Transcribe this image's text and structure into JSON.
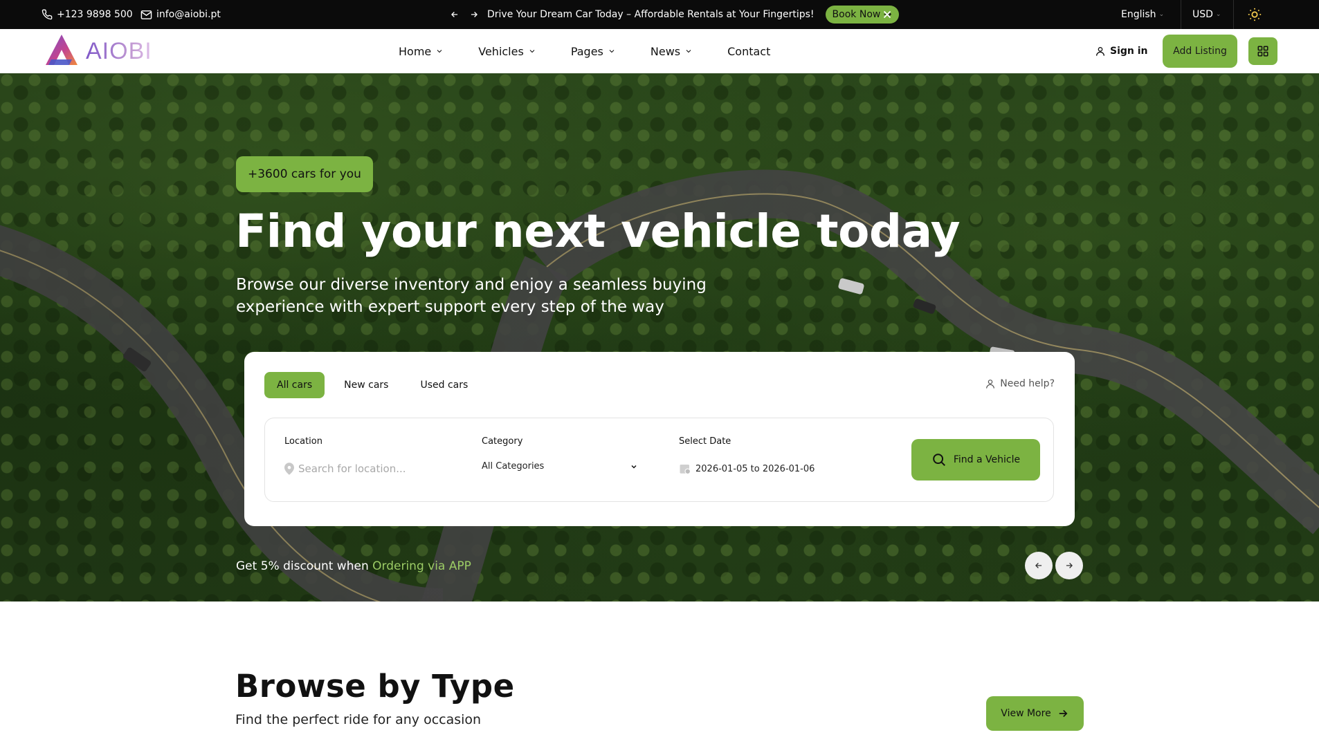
{
  "topbar": {
    "phone": "+123 9898 500",
    "email": "info@aiobi.pt",
    "promo_text": "Drive Your Dream Car Today – Affordable Rentals at Your Fingertips!",
    "book_now": "Book Now →",
    "language": "English",
    "currency": "USD"
  },
  "header": {
    "logo_text": "AIOBI",
    "nav": [
      {
        "label": "Home"
      },
      {
        "label": "Vehicles"
      },
      {
        "label": "Pages"
      },
      {
        "label": "News"
      },
      {
        "label": "Contact"
      }
    ],
    "sign_in": "Sign in",
    "add_listing": "Add Listing"
  },
  "hero": {
    "badge": "+3600 cars for you",
    "title": "Find your next vehicle today",
    "subtitle": "Browse our diverse inventory and enjoy a seamless buying experience with expert support every step of the way",
    "discount_prefix": "Get 5% discount when",
    "discount_link": "Ordering via APP"
  },
  "search": {
    "tabs": [
      {
        "label": "All cars",
        "active": true
      },
      {
        "label": "New cars",
        "active": false
      },
      {
        "label": "Used cars",
        "active": false
      }
    ],
    "help": "Need help?",
    "location_label": "Location",
    "location_placeholder": "Search for location...",
    "category_label": "Category",
    "category_value": "All Categories",
    "date_label": "Select Date",
    "date_value": "2026-01-05 to 2026-01-06",
    "find_button": "Find a Vehicle"
  },
  "browse": {
    "title": "Browse by Type",
    "subtitle": "Find the perfect ride for any occasion",
    "view_more": "View More"
  },
  "colors": {
    "accent": "#7cb342",
    "topbar_bg": "#0b0b0b",
    "link": "#9ccc65"
  }
}
